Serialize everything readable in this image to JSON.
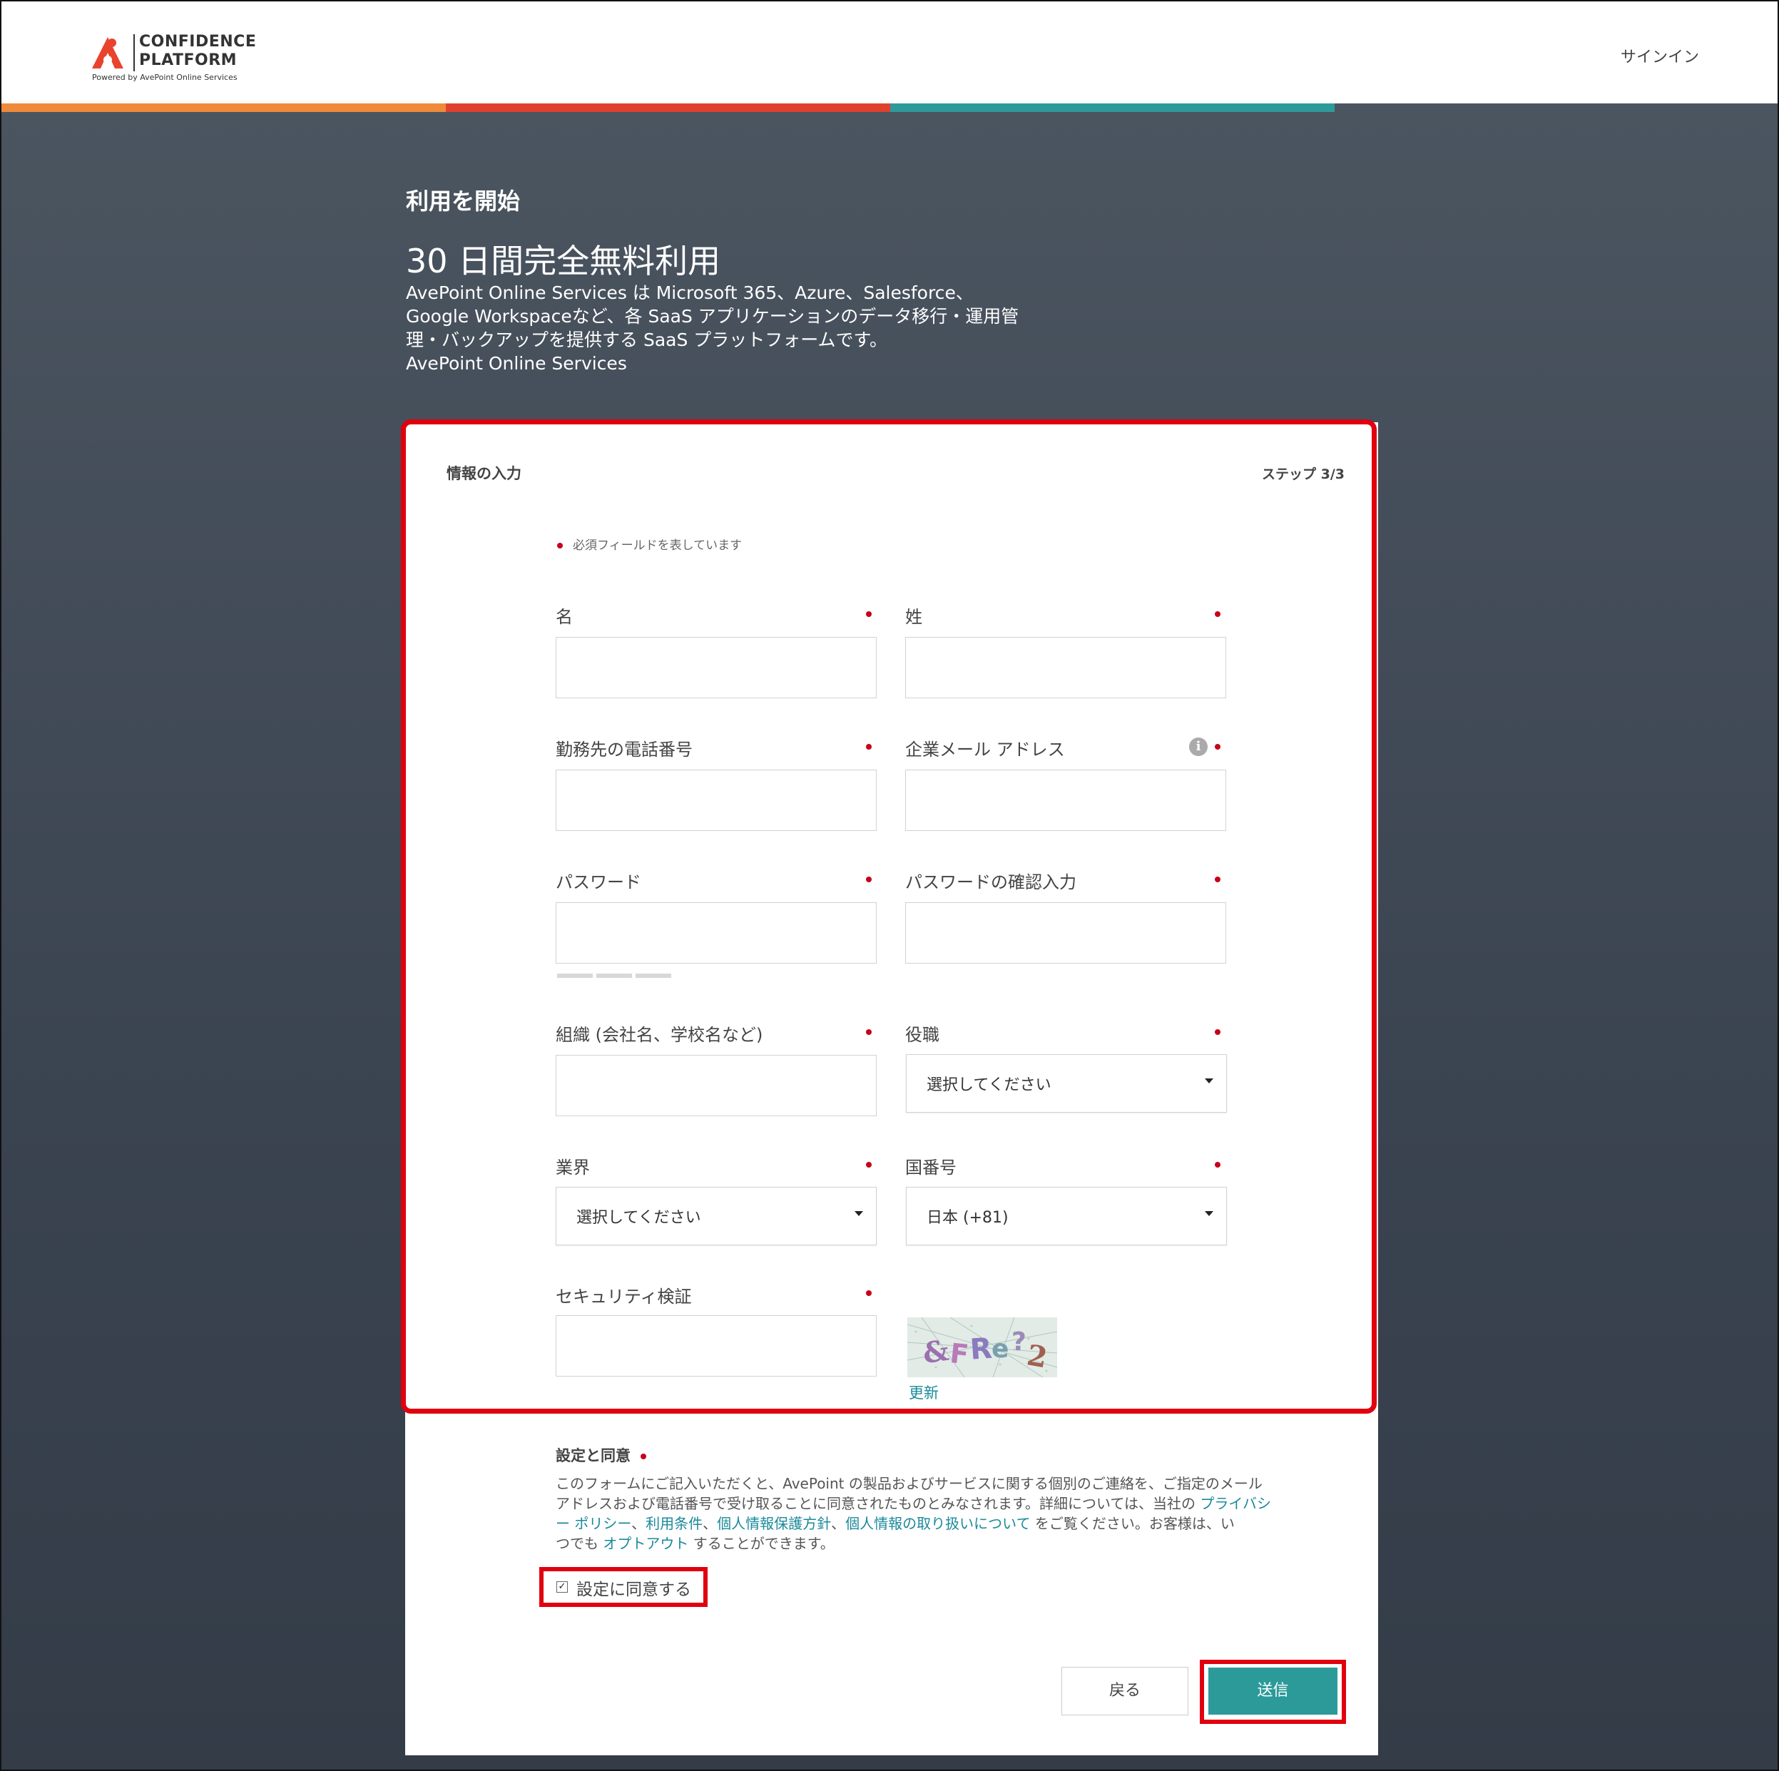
{
  "header": {
    "logo_line1": "CONFIDENCE",
    "logo_line2": "PLATFORM",
    "logo_sub": "Powered by AvePoint Online Services",
    "signin": "サインイン",
    "bar_colors": [
      "#ef8a3a",
      "#e0402e",
      "#2e9a9a",
      "#4b5560"
    ],
    "logo_color": "#e8432f"
  },
  "intro": {
    "title": "利用を開始",
    "subtitle": "30 日間完全無料利用",
    "desc_lines": [
      "AvePoint Online Services は Microsoft 365、Azure、Salesforce、",
      "Google Workspaceなど、各 SaaS アプリケーションのデータ移行・運用管",
      "理・バックアップを提供する SaaS プラットフォームです。",
      "AvePoint Online Services"
    ]
  },
  "form": {
    "title": "情報の入力",
    "step": "ステップ 3/3",
    "required_note": "必須フィールドを表しています",
    "fields": {
      "first_name": {
        "label": "名",
        "value": ""
      },
      "last_name": {
        "label": "姓",
        "value": ""
      },
      "phone": {
        "label": "勤務先の電話番号",
        "value": ""
      },
      "email": {
        "label": "企業メール アドレス",
        "value": ""
      },
      "password": {
        "label": "パスワード",
        "value": ""
      },
      "password_confirm": {
        "label": "パスワードの確認入力",
        "value": ""
      },
      "organization": {
        "label": "組織 (会社名、学校名など)",
        "value": ""
      },
      "job_title": {
        "label": "役職",
        "selected": "選択してください"
      },
      "industry": {
        "label": "業界",
        "selected": "選択してください"
      },
      "country_code": {
        "label": "国番号",
        "selected": "日本 (+81)"
      },
      "captcha": {
        "label": "セキュリティ検証",
        "value": "",
        "image_text": "&FRe?2",
        "refresh": "更新"
      }
    },
    "consent": {
      "title": "設定と同意",
      "text_lines": [
        [
          "このフォームにご記入いただくと、AvePoint の製品およびサービスに関する個別のご連絡を、ご指定のメール"
        ],
        [
          "アドレスおよび電話番号で受け取ることに同意されたものとみなされます。詳細については、当社の "
        ],
        [
          "ー ポリシー",
          "、",
          "利用条件",
          "、",
          "個人情報保護方針",
          "、",
          "個人情報の取り扱いについて",
          " をご覧ください。お客様は、い"
        ],
        [
          "つでも ",
          "オプトアウト",
          " することができます。"
        ]
      ],
      "link_privacy_head": "プライバシ",
      "checkbox_label": "設定に同意する",
      "checkbox_checked": true
    },
    "buttons": {
      "back": "戻る",
      "submit": "送信"
    },
    "accent_color": "#2d9a9a",
    "highlight_color": "#e0000e"
  }
}
